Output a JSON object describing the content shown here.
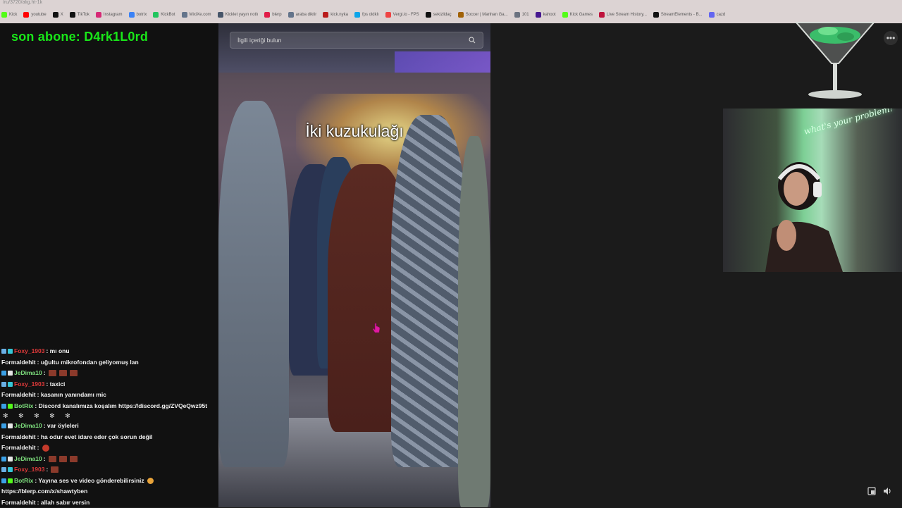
{
  "browser": {
    "url_fragment": "/ru/3720/alig.ht-1k",
    "bookmarks": [
      {
        "label": "Kick",
        "color": "#53fc18"
      },
      {
        "label": "youtube",
        "color": "#ff0000"
      },
      {
        "label": "X",
        "color": "#111111"
      },
      {
        "label": "TikTok",
        "color": "#111111"
      },
      {
        "label": "Instagram",
        "color": "#d62976"
      },
      {
        "label": "botrix",
        "color": "#3b82f6"
      },
      {
        "label": "KickBot",
        "color": "#22c55e"
      },
      {
        "label": "MixiXe.com",
        "color": "#64748b"
      },
      {
        "label": "Kicklet yayın notlı",
        "color": "#475569"
      },
      {
        "label": "blerp",
        "color": "#e11d48"
      },
      {
        "label": "araba diktir",
        "color": "#64748b"
      },
      {
        "label": "kick.nyka",
        "color": "#b91c1c"
      },
      {
        "label": "fps oldklı",
        "color": "#0ea5e9"
      },
      {
        "label": "Vergi.io - FPS",
        "color": "#ef4444"
      },
      {
        "label": "sekizlidaç",
        "color": "#111111"
      },
      {
        "label": "Soccer | Manhan Ga...",
        "color": "#a16207"
      },
      {
        "label": "101",
        "color": "#6b7280"
      },
      {
        "label": "kahoot",
        "color": "#46178f"
      },
      {
        "label": "Kick Games",
        "color": "#53fc18"
      },
      {
        "label": "Live Stream History...",
        "color": "#be123c"
      },
      {
        "label": "StreamElements - B...",
        "color": "#111111"
      },
      {
        "label": "cazd",
        "color": "#6366f1"
      }
    ]
  },
  "overlay": {
    "last_sub_label": "son abone: D4rk1L0rd"
  },
  "chat": {
    "messages": [
      {
        "user": "Foxy_1903",
        "user_color": "#e03a3a",
        "badges": [
          "#6ab0e6",
          "#35c6d6"
        ],
        "text": ": mı onu",
        "emotes": []
      },
      {
        "user": "Formaldehit",
        "user_color": "#f2f2f2",
        "badges": [],
        "text": ": uğultu mikrofondan geliyomuş lan",
        "emotes": []
      },
      {
        "user": "JeDima10",
        "user_color": "#7ee07e",
        "badges": [
          "#3ba0e6",
          "#e6e6e6"
        ],
        "text": ":",
        "emotes": [
          "brown",
          "brown",
          "brown"
        ]
      },
      {
        "user": "Foxy_1903",
        "user_color": "#e03a3a",
        "badges": [
          "#6ab0e6",
          "#35c6d6"
        ],
        "text": ": taxici",
        "emotes": []
      },
      {
        "user": "Formaldehit",
        "user_color": "#f2f2f2",
        "badges": [],
        "text": ": kasanın yanındamı mic",
        "emotes": []
      },
      {
        "user": "BotRix",
        "user_color": "#7ee07e",
        "badges": [
          "#3ba0e6",
          "#53fc18"
        ],
        "text": ": Discord kanalımıza koşalım https://discord.gg/ZVQeQwz95t",
        "emotes": []
      },
      {
        "user": "JeDima10",
        "user_color": "#7ee07e",
        "badges": [
          "#3ba0e6",
          "#e6e6e6"
        ],
        "text": ": var öyleleri",
        "emotes": []
      },
      {
        "user": "Formaldehit",
        "user_color": "#f2f2f2",
        "badges": [],
        "text": ": ha odur evet idare eder çok sorun değil",
        "emotes": []
      },
      {
        "user": "Formaldehit",
        "user_color": "#f2f2f2",
        "badges": [],
        "text": ":",
        "emotes": [
          "red"
        ]
      },
      {
        "user": "JeDima10",
        "user_color": "#7ee07e",
        "badges": [
          "#3ba0e6",
          "#e6e6e6"
        ],
        "text": ":",
        "emotes": [
          "brown",
          "brown",
          "brown"
        ]
      },
      {
        "user": "Foxy_1903",
        "user_color": "#e03a3a",
        "badges": [
          "#6ab0e6",
          "#35c6d6"
        ],
        "text": ":",
        "emotes": [
          "brown"
        ]
      },
      {
        "user": "BotRix",
        "user_color": "#7ee07e",
        "badges": [
          "#3ba0e6",
          "#53fc18"
        ],
        "text": ": Yayına ses ve video gönderebilirsiniz",
        "emotes": [
          "orange"
        ]
      },
      {
        "user": "",
        "user_color": "#f2f2f2",
        "badges": [],
        "text": "https://blerp.com/x/shawtyben",
        "emotes": []
      },
      {
        "user": "Formaldehit",
        "user_color": "#f2f2f2",
        "badges": [],
        "text": ": allah sabır versin",
        "emotes": []
      }
    ]
  },
  "video": {
    "search_placeholder": "İlgili içeriği bulun",
    "caption": "İki kuzukulağı"
  },
  "webcam": {
    "neon_text": "what's your problem?"
  }
}
